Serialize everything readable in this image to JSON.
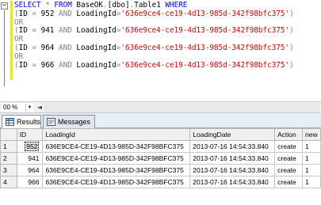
{
  "editor": {
    "collapse_glyph": "−",
    "lines": [
      [
        {
          "t": "SELECT",
          "c": "kw"
        },
        {
          "t": " ",
          "c": "tx"
        },
        {
          "t": "*",
          "c": "op"
        },
        {
          "t": " ",
          "c": "tx"
        },
        {
          "t": "FROM",
          "c": "kw"
        },
        {
          "t": " BaseOK",
          "c": "tx"
        },
        {
          "t": ".",
          "c": "op"
        },
        {
          "t": "[dbo]",
          "c": "tx"
        },
        {
          "t": ".",
          "c": "op"
        },
        {
          "t": "Table1 ",
          "c": "tx"
        },
        {
          "t": "WHERE",
          "c": "kw"
        }
      ],
      [
        {
          "t": "(",
          "c": "op"
        },
        {
          "t": "ID ",
          "c": "tx"
        },
        {
          "t": "=",
          "c": "op"
        },
        {
          "t": " 952 ",
          "c": "tx"
        },
        {
          "t": "AND",
          "c": "op"
        },
        {
          "t": " LoadingId",
          "c": "tx"
        },
        {
          "t": "=",
          "c": "op"
        },
        {
          "t": "'636e9ce4-ce19-4d13-985d-342f98bfc375'",
          "c": "st"
        },
        {
          "t": ")",
          "c": "op"
        }
      ],
      [
        {
          "t": "OR",
          "c": "op"
        }
      ],
      [
        {
          "t": "(",
          "c": "op"
        },
        {
          "t": "ID ",
          "c": "tx"
        },
        {
          "t": "=",
          "c": "op"
        },
        {
          "t": " 941 ",
          "c": "tx"
        },
        {
          "t": "AND",
          "c": "op"
        },
        {
          "t": " LoadingId",
          "c": "tx"
        },
        {
          "t": "=",
          "c": "op"
        },
        {
          "t": "'636e9ce4-ce19-4d13-985d-342f98bfc375'",
          "c": "st"
        },
        {
          "t": ")",
          "c": "op"
        }
      ],
      [
        {
          "t": "OR",
          "c": "op"
        }
      ],
      [
        {
          "t": "(",
          "c": "op"
        },
        {
          "t": "ID ",
          "c": "tx"
        },
        {
          "t": "=",
          "c": "op"
        },
        {
          "t": " 964 ",
          "c": "tx"
        },
        {
          "t": "AND",
          "c": "op"
        },
        {
          "t": " LoadingId",
          "c": "tx"
        },
        {
          "t": "=",
          "c": "op"
        },
        {
          "t": "'636e9ce4-ce19-4d13-985d-342f98bfc375'",
          "c": "st"
        },
        {
          "t": ")",
          "c": "op"
        }
      ],
      [
        {
          "t": "OR",
          "c": "op"
        }
      ],
      [
        {
          "t": "(",
          "c": "op"
        },
        {
          "t": "ID ",
          "c": "tx"
        },
        {
          "t": "=",
          "c": "op"
        },
        {
          "t": " 966 ",
          "c": "tx"
        },
        {
          "t": "AND",
          "c": "op"
        },
        {
          "t": " LoadingId",
          "c": "tx"
        },
        {
          "t": "=",
          "c": "op"
        },
        {
          "t": "'636e9ce4-ce19-4d13-985d-342f98bfc375'",
          "c": "st"
        },
        {
          "t": ")",
          "c": "op"
        }
      ]
    ]
  },
  "zoom": {
    "value": "00 %",
    "arrow": "▼",
    "scroll_left": "◄"
  },
  "tabs": [
    {
      "label": "Results",
      "icon": "grid-icon"
    },
    {
      "label": "Messages",
      "icon": "messages-icon"
    }
  ],
  "grid": {
    "columns": [
      "ID",
      "LoadingId",
      "LoadingDate",
      "Action",
      "new"
    ],
    "rows": [
      [
        "1",
        "952",
        "636E9CE4-CE19-4D13-985D-342F98BFC375",
        "2013-07-16 14:54:33.840",
        "create",
        "1"
      ],
      [
        "2",
        "941",
        "636E9CE4-CE19-4D13-985D-342F98BFC375",
        "2013-07-16 14:54:33.840",
        "create",
        "1"
      ],
      [
        "3",
        "964",
        "636E9CE4-CE19-4D13-985D-342F98BFC375",
        "2013-07-16 14:54:33.840",
        "create",
        "1"
      ],
      [
        "4",
        "966",
        "636E9CE4-CE19-4D13-985D-342F98BFC375",
        "2013-07-16 14:54:33.840",
        "create",
        "1"
      ]
    ]
  }
}
